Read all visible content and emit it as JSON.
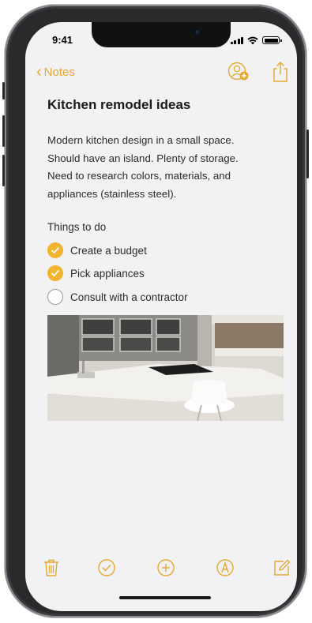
{
  "status": {
    "time": "9:41"
  },
  "nav": {
    "back_label": "Notes"
  },
  "note": {
    "title": "Kitchen remodel ideas",
    "body_lines": [
      "Modern kitchen design in a small space.",
      "Should have an island. Plenty of storage.",
      "Need to research colors, materials, and",
      "appliances (stainless steel)."
    ],
    "checklist_heading": "Things to do",
    "checklist": [
      {
        "label": "Create a budget",
        "checked": true
      },
      {
        "label": "Pick appliances",
        "checked": true
      },
      {
        "label": "Consult with a contractor",
        "checked": false
      }
    ]
  },
  "toolbar": [
    "trash-icon",
    "checklist-icon",
    "add-icon",
    "markup-icon",
    "compose-icon"
  ],
  "colors": {
    "accent": "#E4A834",
    "check_fill": "#F2B430",
    "screen_bg": "#F2F2F4"
  }
}
